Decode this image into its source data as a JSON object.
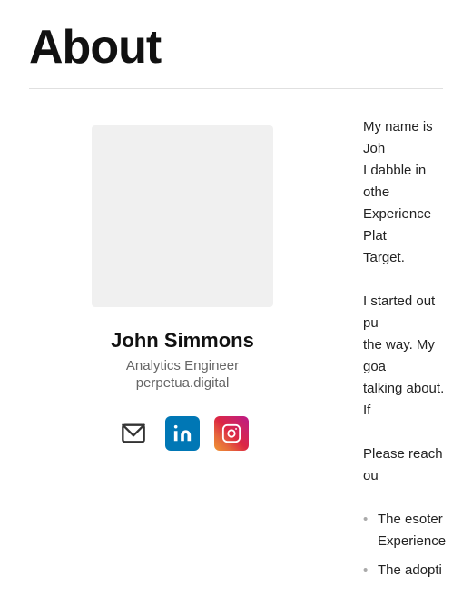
{
  "page": {
    "title": "About"
  },
  "divider": true,
  "person": {
    "name": "John Simmons",
    "title": "Analytics Engineer",
    "website": "perpetua.digital",
    "avatar_alt": "Profile photo"
  },
  "social": {
    "email_label": "Email",
    "linkedin_label": "LinkedIn",
    "instagram_label": "Instagram"
  },
  "bio": {
    "paragraph1": "My name is Joh... I dabble in othe... Experience Plat... Target.",
    "paragraph1_line1": "My name is Joh",
    "paragraph1_line2": "I dabble in othe",
    "paragraph1_line3": "Experience Plat",
    "paragraph1_line4": "Target.",
    "paragraph2_line1": "I started out pu",
    "paragraph2_line2": "the way. My goa",
    "paragraph2_line3": "talking about. If",
    "paragraph3_line1": "Please reach ou",
    "bullet1": "The esoter... Experience...",
    "bullet1_line1": "The esoter",
    "bullet1_line2": "Experience",
    "bullet2": "The adopti",
    "bullet2_line1": "The adopti"
  }
}
